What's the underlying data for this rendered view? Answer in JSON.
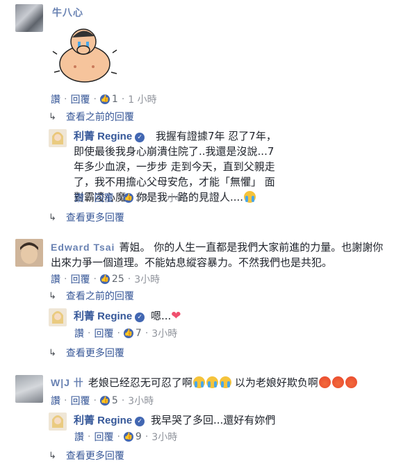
{
  "icons": {
    "like": "like-thumb-icon",
    "reply_arrow": "reply-arrow-icon",
    "verified": "verified-badge-icon",
    "sticker": "crying-man-sticker"
  },
  "colors": {
    "link": "#385898",
    "name": "#365899",
    "like_badge": "#4267b2",
    "meta": "#606770"
  },
  "actions": {
    "like": "讚",
    "reply": "回覆",
    "sep": "·"
  },
  "threads": [
    {
      "author": "牛八心",
      "like_count": "1",
      "time": "1 小時",
      "view_previous": "查看之前的回覆",
      "reply": {
        "author": "利菁 Regine",
        "text": "我握有證據7年 忍了7年，即使最後我身心崩潰住院了..我還是沒說...7年多少血淚，一步步 走到今天，直到父親走了，我不用擔心父母安危，才能「無懼」 面對霸凌心魔。你是我一路的見證人....",
        "like_count": "33",
        "time": "1 小時"
      },
      "view_more": "查看更多回覆"
    },
    {
      "author": "Edward Tsai",
      "text": "菁姐。 你的人生一直都是我們大家前進的力量。也謝謝你出來力爭一個道理。不能姑息縱容暴力。不然我們也是共犯。",
      "like_count": "25",
      "time": "3小時",
      "view_previous": "查看之前的回覆",
      "reply": {
        "author": "利菁 Regine",
        "text": "嗯...",
        "like_count": "7",
        "time": "3小時"
      },
      "view_more": "查看更多回覆"
    },
    {
      "author": "W|J 卄",
      "text_a": "老娘已经忍无可忍了啊",
      "text_b": "以为老娘好欺负啊",
      "like_count": "5",
      "time": "3小時",
      "reply": {
        "author": "利菁 Regine",
        "text": "我早哭了多回...還好有妳們",
        "like_count": "9",
        "time": "3小時"
      },
      "view_more": "查看更多回覆"
    }
  ]
}
